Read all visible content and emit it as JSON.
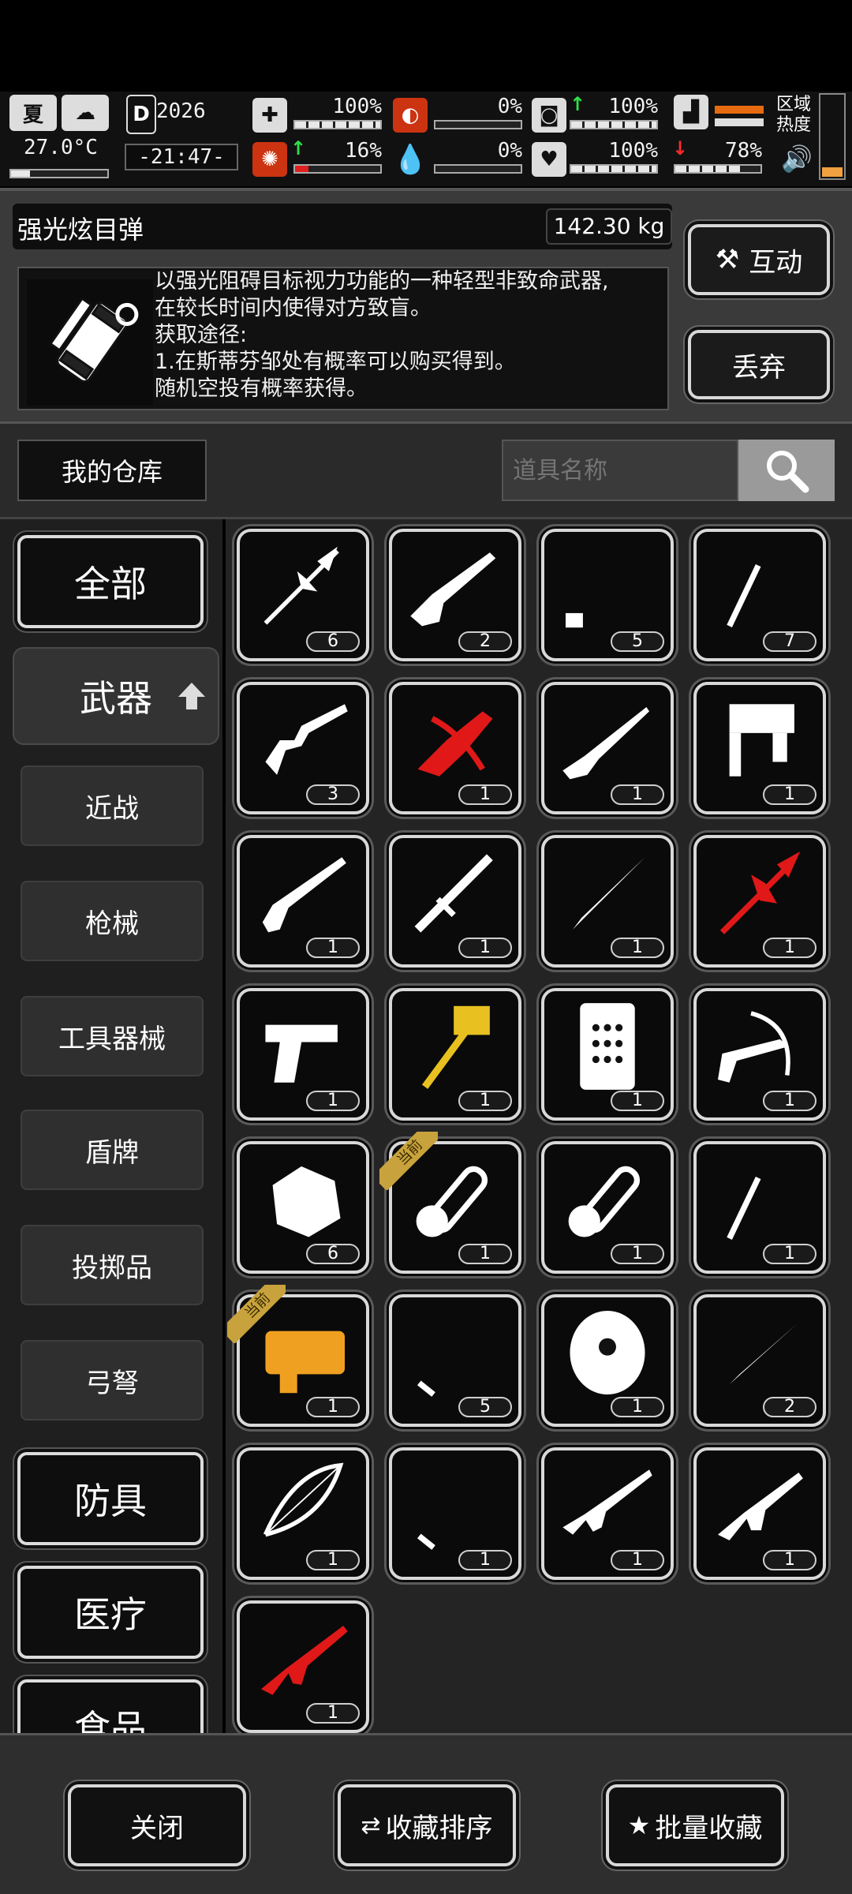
{
  "hud": {
    "season_icon": "summer-icon",
    "season_label": "夏",
    "temperature": "27.0°C",
    "day": "2026",
    "day_icon_label": "D",
    "clock": "-21:47-",
    "stats": [
      {
        "id": "health",
        "icon": "medkit-icon",
        "value": "100%",
        "fill": 1.0
      },
      {
        "id": "hunger",
        "icon": "stomach-icon",
        "value": "0%",
        "fill": 0.0
      },
      {
        "id": "thirst",
        "icon": "bottle-icon",
        "value": "100%",
        "fill": 1.0
      },
      {
        "id": "stamina",
        "icon": "boot-icon",
        "value": "",
        "fill": 0.55
      },
      {
        "id": "brain",
        "icon": "brain-icon",
        "value": "16%",
        "fill": 0.16
      },
      {
        "id": "blood",
        "icon": "blood-drop-icon",
        "value": "0%",
        "fill": 0.0
      },
      {
        "id": "heart",
        "icon": "heart-icon",
        "value": "100%",
        "fill": 1.0
      },
      {
        "id": "energy",
        "icon": "energy-icon",
        "value": "78%",
        "fill": 0.78
      }
    ],
    "region_label_1": "区域",
    "region_label_2": "热度"
  },
  "detail": {
    "name": "强光炫目弹",
    "weight": "142.30 kg",
    "description": "以强光阻碍目标视力功能的一种轻型非致命武器,\n在较长时间内使得对方致盲。\n获取途径:\n1.在斯蒂芬邹处有概率可以购买得到。\n随机空投有概率获得。",
    "interact_label": "互动",
    "discard_label": "丢弃"
  },
  "warehouse": {
    "title": "我的仓库",
    "search_placeholder": "道具名称"
  },
  "categories": {
    "all": "全部",
    "weapons": "武器",
    "melee": "近战",
    "firearms": "枪械",
    "tools": "工具器械",
    "shields": "盾牌",
    "throwables": "投掷品",
    "bows": "弓弩",
    "armor": "防具",
    "medical": "医疗",
    "food": "食品"
  },
  "items": [
    {
      "icon": "spear-icon",
      "count": "6",
      "color": "#ffffff"
    },
    {
      "icon": "shotgun-icon",
      "count": "2",
      "color": "#ffffff"
    },
    {
      "icon": "kukri-icon",
      "count": "5",
      "color": "#ffffff"
    },
    {
      "icon": "pickaxe-icon",
      "count": "7",
      "color": "#ffffff"
    },
    {
      "icon": "revolver-icon",
      "count": "3",
      "color": "#ffffff"
    },
    {
      "icon": "red-crossbow-icon",
      "count": "1",
      "color": "#e01818"
    },
    {
      "icon": "rifle-icon",
      "count": "1",
      "color": "#ffffff"
    },
    {
      "icon": "nail-gun-icon",
      "count": "1",
      "color": "#ffffff"
    },
    {
      "icon": "sawed-off-shotgun-icon",
      "count": "1",
      "color": "#ffffff"
    },
    {
      "icon": "baton-icon",
      "count": "1",
      "color": "#ffffff"
    },
    {
      "icon": "machete-icon",
      "count": "1",
      "color": "#ffffff"
    },
    {
      "icon": "red-spear-icon",
      "count": "1",
      "color": "#e01818"
    },
    {
      "icon": "pistol-icon",
      "count": "1",
      "color": "#ffffff"
    },
    {
      "icon": "golden-hammer-icon",
      "count": "1",
      "color": "#e8c020"
    },
    {
      "icon": "riot-shield-icon",
      "count": "1",
      "color": "#ffffff"
    },
    {
      "icon": "pistol-crossbow-icon",
      "count": "1",
      "color": "#ffffff"
    },
    {
      "icon": "rock-icon",
      "count": "6",
      "color": "#ffffff"
    },
    {
      "icon": "chainsaw-icon",
      "count": "1",
      "color": "#ffffff",
      "current": "当前"
    },
    {
      "icon": "chainsaw-icon",
      "count": "1",
      "color": "#ffffff"
    },
    {
      "icon": "pickaxe-icon",
      "count": "1",
      "color": "#ffffff"
    },
    {
      "icon": "golden-blaster-icon",
      "count": "1",
      "color": "#f0a020",
      "current": "当前"
    },
    {
      "icon": "katana-icon",
      "count": "5",
      "color": "#ffffff"
    },
    {
      "icon": "round-shield-icon",
      "count": "1",
      "color": "#ffffff"
    },
    {
      "icon": "dagger-icon",
      "count": "2",
      "color": "#ffffff"
    },
    {
      "icon": "bow-icon",
      "count": "1",
      "color": "#ffffff"
    },
    {
      "icon": "katana-icon",
      "count": "1",
      "color": "#ffffff"
    },
    {
      "icon": "assault-rifle-icon",
      "count": "1",
      "color": "#ffffff"
    },
    {
      "icon": "carbine-icon",
      "count": "1",
      "color": "#ffffff"
    },
    {
      "icon": "red-assault-rifle-icon",
      "count": "1",
      "color": "#e01818"
    }
  ],
  "bottom": {
    "close": "关闭",
    "sort_favorites": "收藏排序",
    "batch_favorite": "批量收藏"
  }
}
